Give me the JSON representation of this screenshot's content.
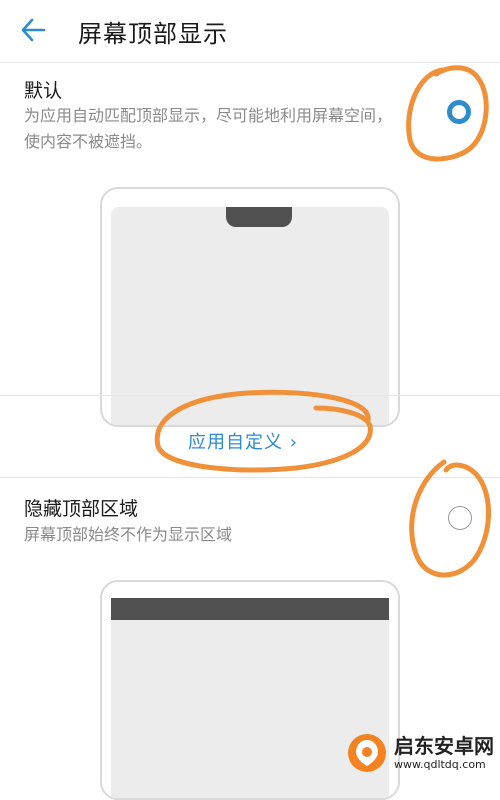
{
  "header": {
    "title": "屏幕顶部显示",
    "back_icon": "arrow-left-icon"
  },
  "options": [
    {
      "title": "默认",
      "description": "为应用自动匹配顶部显示，尽可能地利用屏幕空间，使内容不被遮挡。",
      "selected": true
    },
    {
      "title": "隐藏顶部区域",
      "description": "屏幕顶部始终不作为显示区域",
      "selected": false
    }
  ],
  "custom_link": {
    "label": "应用自定义 ›"
  },
  "colors": {
    "accent": "#2b8ccf",
    "annotation": "#f0913a"
  },
  "watermark": {
    "name": "启东安卓网",
    "url": "www.qdltdq.com"
  }
}
